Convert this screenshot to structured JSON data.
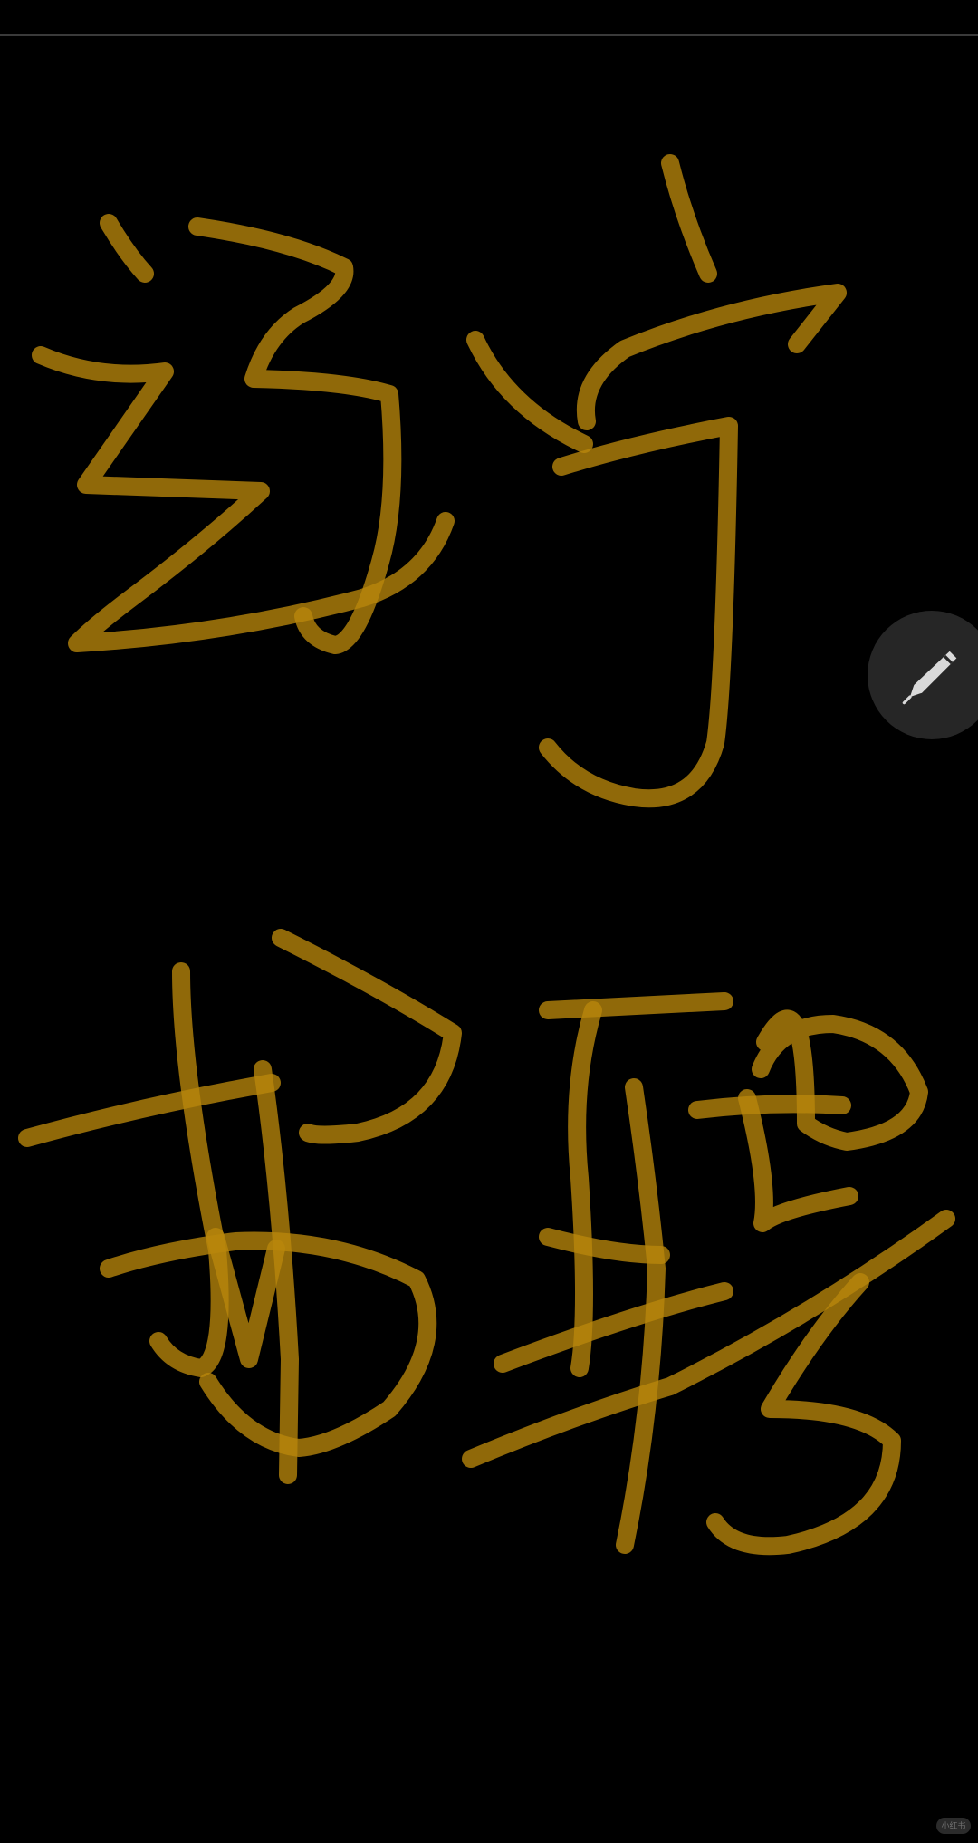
{
  "screen": {
    "background": "#000000",
    "divider_color": "#3a3a3a"
  },
  "drawing": {
    "ink_color": "#b8860b",
    "handwritten_text": "辽宁招聘",
    "characters": [
      "辽",
      "宁",
      "招",
      "聘"
    ]
  },
  "edit_button": {
    "icon": "pencil-icon",
    "background": "#262626",
    "icon_color": "#d9d9d9"
  },
  "watermark": {
    "label": "小红书"
  }
}
